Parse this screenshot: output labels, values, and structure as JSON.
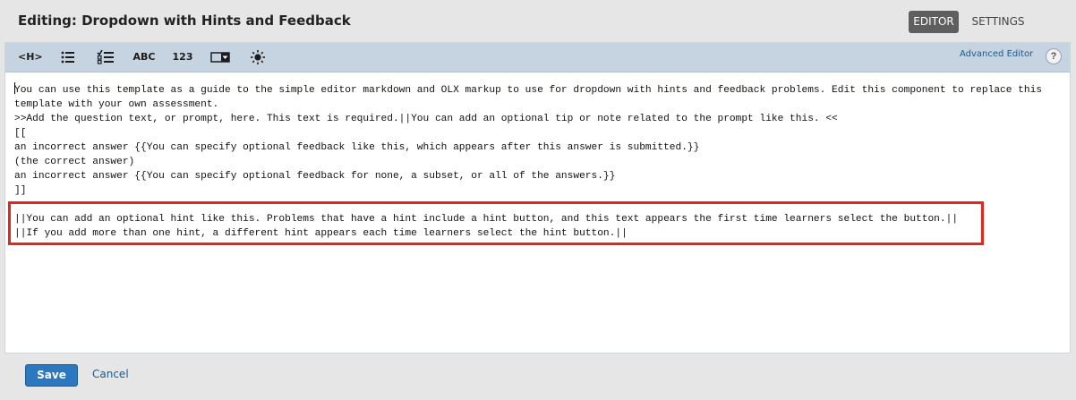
{
  "header": {
    "title": "Editing: Dropdown with Hints and Feedback",
    "tabs": [
      {
        "label": "EDITOR",
        "active": true
      },
      {
        "label": "SETTINGS",
        "active": false
      }
    ]
  },
  "toolbar": {
    "buttons": {
      "heading": "<H>",
      "multiple_choice_icon": "multiple-choice-icon",
      "checkboxes_icon": "checkboxes-icon",
      "text_input": "ABC",
      "numerical_input": "123",
      "dropdown_icon": "dropdown-icon",
      "explanation_icon": "explanation-icon"
    },
    "advanced_editor": "Advanced Editor",
    "help": "?"
  },
  "editor": {
    "lines": [
      "You can use this template as a guide to the simple editor markdown and OLX markup to use for dropdown with hints and feedback problems. Edit this component to replace this",
      "template with your own assessment.",
      ">>Add the question text, or prompt, here. This text is required.||You can add an optional tip or note related to the prompt like this. <<",
      "[[",
      "an incorrect answer {{You can specify optional feedback like this, which appears after this answer is submitted.}}",
      "(the correct answer)",
      "an incorrect answer {{You can specify optional feedback for none, a subset, or all of the answers.}}",
      "]]",
      "",
      "||You can add an optional hint like this. Problems that have a hint include a hint button, and this text appears the first time learners select the button.||",
      "||If you add more than one hint, a different hint appears each time learners select the hint button.||"
    ]
  },
  "footer": {
    "save_label": "Save",
    "cancel_label": "Cancel"
  },
  "colors": {
    "highlight_border": "#e4261d",
    "save_button": "#2c78c0",
    "toolbar_bg": "#c6d3e0"
  }
}
